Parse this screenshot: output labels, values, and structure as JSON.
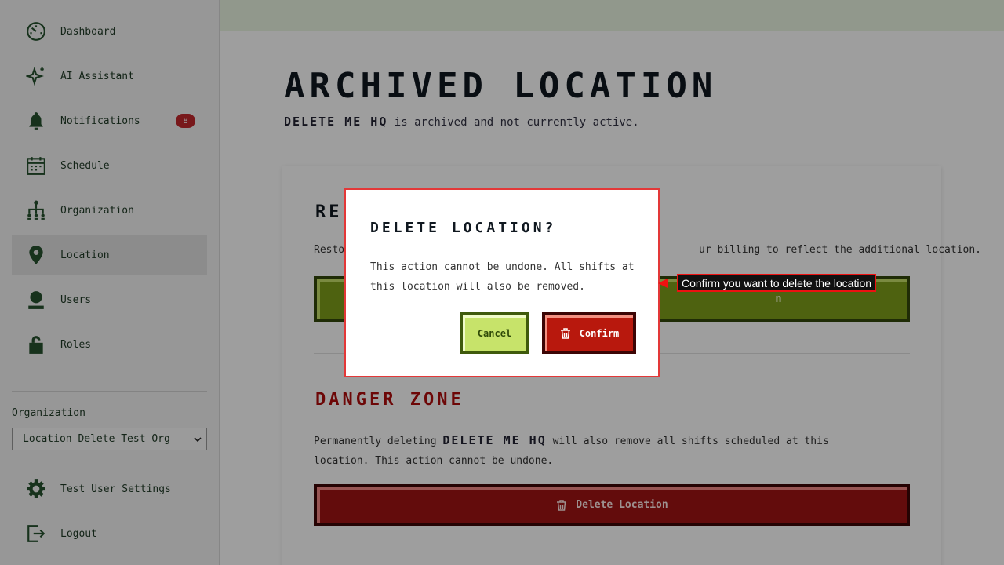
{
  "sidebar": {
    "items": [
      {
        "label": "Dashboard",
        "icon": "dashboard-icon"
      },
      {
        "label": "AI Assistant",
        "icon": "sparkle-icon"
      },
      {
        "label": "Notifications",
        "icon": "bell-icon",
        "badge": "8"
      },
      {
        "label": "Schedule",
        "icon": "calendar-icon"
      },
      {
        "label": "Organization",
        "icon": "org-chart-icon"
      },
      {
        "label": "Location",
        "icon": "location-pin-icon",
        "active": true
      },
      {
        "label": "Users",
        "icon": "user-icon"
      },
      {
        "label": "Roles",
        "icon": "lock-icon"
      }
    ],
    "org_label": "Organization",
    "org_selected": "Location Delete Test Org",
    "settings_label": "Test User Settings",
    "logout_label": "Logout"
  },
  "main": {
    "title": "ARCHIVED LOCATION",
    "subtitle_name": "DELETE ME HQ",
    "subtitle_rest": " is archived and not currently active.",
    "restore_title": "RE",
    "restore_text_start": "Restor",
    "restore_text_end": "ur billing to reflect the additional location.",
    "restore_button_tail": "n",
    "danger_title": "DANGER ZONE",
    "danger_text_pre": "Permanently deleting ",
    "danger_text_name": "DELETE ME HQ",
    "danger_text_post": " will also remove all shifts scheduled at this location. This action cannot be undone.",
    "delete_button": "Delete Location"
  },
  "modal": {
    "title": "DELETE LOCATION?",
    "text": "This action cannot be undone. All shifts at this location will also be removed.",
    "cancel": "Cancel",
    "confirm": "Confirm"
  },
  "hint": "Confirm you want to delete the location",
  "colors": {
    "accent_green": "#7f9e1a",
    "danger_red": "#a01414",
    "badge_red": "#c2272d",
    "hint_border": "#ee1111"
  }
}
